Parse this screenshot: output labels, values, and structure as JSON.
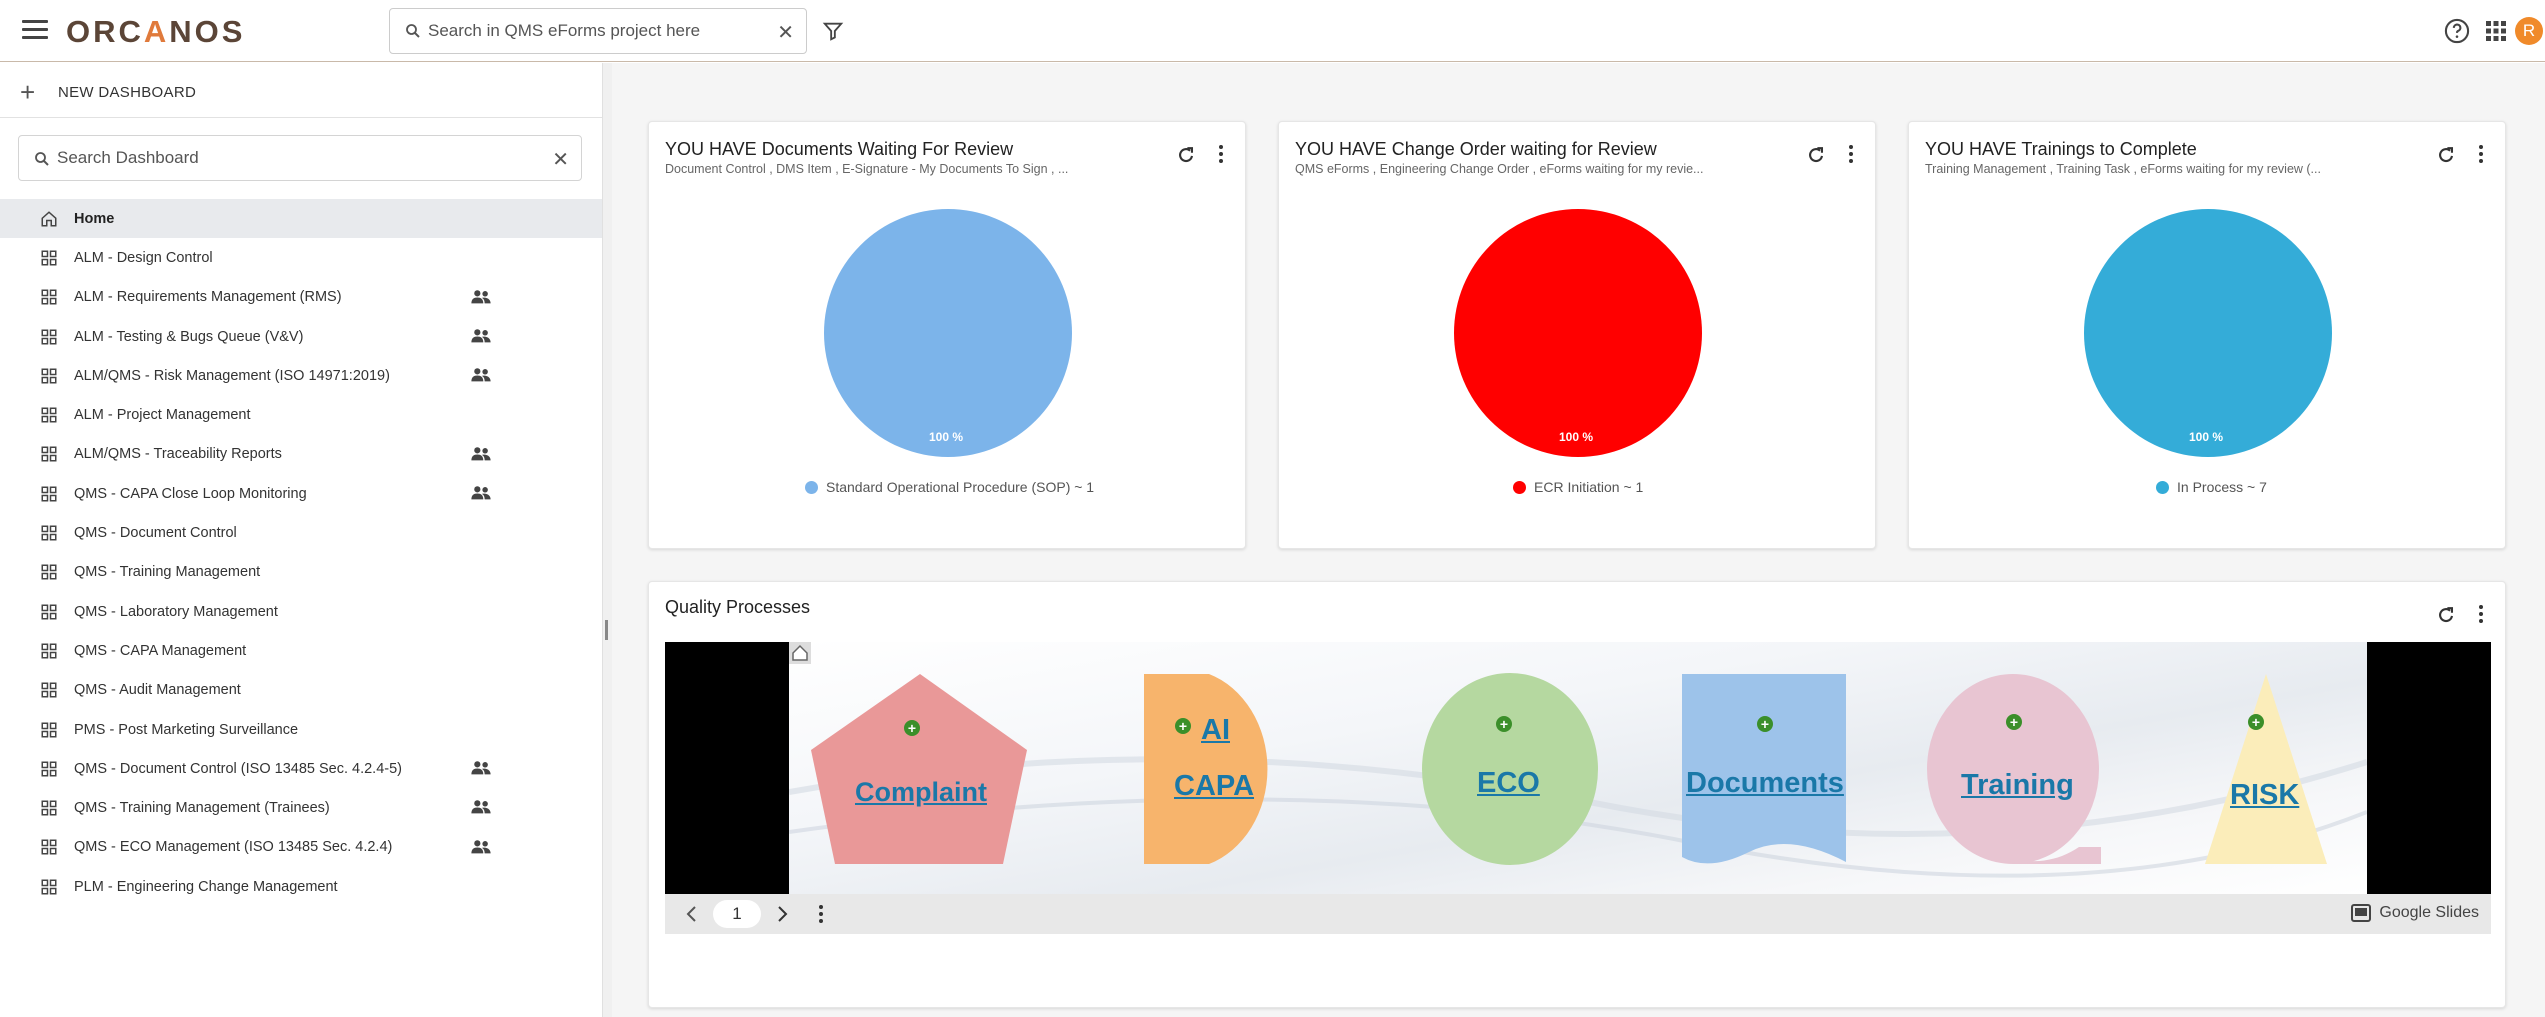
{
  "header": {
    "logo_text": "ORCANOS",
    "search_placeholder": "Search in QMS eForms project here",
    "avatar_initial": "R",
    "brand_color": "#e07a3b"
  },
  "sidebar": {
    "new_dashboard_label": "NEW DASHBOARD",
    "search_placeholder": "Search Dashboard",
    "items": [
      {
        "label": "Home",
        "icon": "home-icon",
        "active": true,
        "shared": false
      },
      {
        "label": "ALM - Design Control",
        "icon": "grid-icon",
        "shared": false
      },
      {
        "label": "ALM - Requirements Management (RMS)",
        "icon": "grid-icon",
        "shared": true
      },
      {
        "label": "ALM - Testing & Bugs Queue (V&V)",
        "icon": "grid-icon",
        "shared": true
      },
      {
        "label": "ALM/QMS - Risk Management (ISO 14971:2019)",
        "icon": "grid-icon",
        "shared": true
      },
      {
        "label": "ALM - Project Management",
        "icon": "grid-icon",
        "shared": false
      },
      {
        "label": "ALM/QMS - Traceability Reports",
        "icon": "grid-icon",
        "shared": true
      },
      {
        "label": "QMS - CAPA Close Loop Monitoring",
        "icon": "grid-icon",
        "shared": true
      },
      {
        "label": "QMS - Document Control",
        "icon": "grid-icon",
        "shared": false
      },
      {
        "label": "QMS - Training Management",
        "icon": "grid-icon",
        "shared": false
      },
      {
        "label": "QMS - Laboratory Management",
        "icon": "grid-icon",
        "shared": false
      },
      {
        "label": "QMS - CAPA Management",
        "icon": "grid-icon",
        "shared": false
      },
      {
        "label": "QMS - Audit Management",
        "icon": "grid-icon",
        "shared": false
      },
      {
        "label": "PMS - Post Marketing Surveillance",
        "icon": "grid-icon",
        "shared": false
      },
      {
        "label": "QMS - Document Control (ISO 13485 Sec. 4.2.4-5)",
        "icon": "grid-icon",
        "shared": true
      },
      {
        "label": "QMS - Training Management (Trainees)",
        "icon": "grid-icon",
        "shared": true
      },
      {
        "label": "QMS - ECO Management (ISO 13485 Sec. 4.2.4)",
        "icon": "grid-icon",
        "shared": true
      },
      {
        "label": "PLM - Engineering Change Management",
        "icon": "grid-icon",
        "shared": false
      }
    ]
  },
  "cards": [
    {
      "title": "YOU HAVE Documents Waiting For Review",
      "subtitle": "Document Control , DMS Item , E-Signature - My Documents To Sign , ...",
      "pie_color": "#7cb4ea",
      "pie_percent": "100 %",
      "legend": "Standard Operational Procedure (SOP) ~ 1"
    },
    {
      "title": "YOU HAVE Change Order waiting for Review",
      "subtitle": "QMS eForms , Engineering Change Order , eForms waiting for my revie...",
      "pie_color": "#ff0000",
      "pie_percent": "100 %",
      "legend": "ECR Initiation ~ 1"
    },
    {
      "title": "YOU HAVE Trainings to Complete",
      "subtitle": "Training Management , Training Task , eForms waiting for my review (...",
      "pie_color": "#34acd8",
      "pie_percent": "100 %",
      "legend": "In Process ~ 7"
    }
  ],
  "quality": {
    "title": "Quality Processes",
    "shapes": {
      "complaint": "Complaint",
      "capa_ai": "AI",
      "capa": "CAPA",
      "eco": "ECO",
      "documents": "Documents",
      "training": "Training",
      "risk": "RISK"
    },
    "page_number": "1",
    "google_slides_label": "Google Slides"
  }
}
